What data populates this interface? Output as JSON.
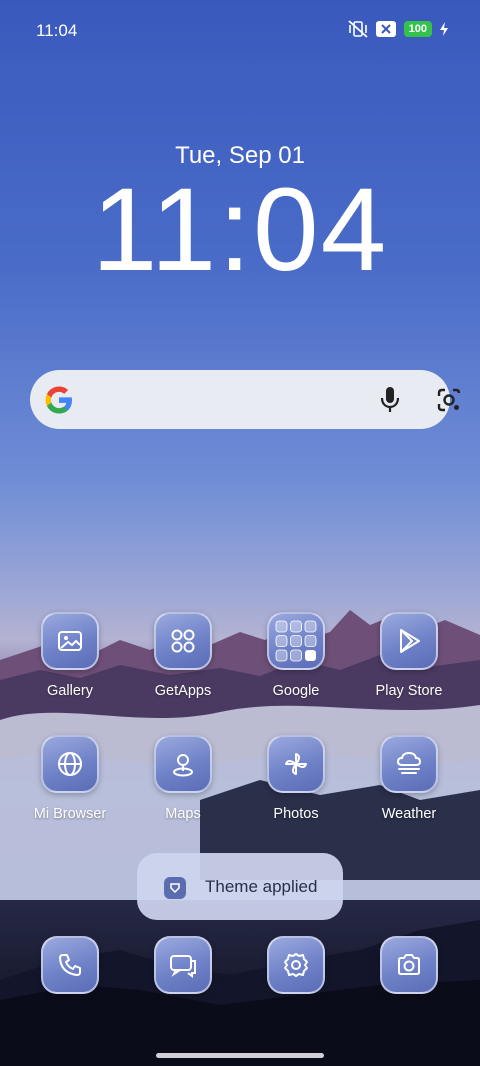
{
  "status_bar": {
    "time": "11:04",
    "battery": "100",
    "icons": [
      "vibrate-off-icon",
      "close-box-icon",
      "battery-icon",
      "charging-icon"
    ]
  },
  "clock_widget": {
    "date": "Tue, Sep 01",
    "time": "11:04"
  },
  "search_bar": {
    "icons": [
      "google-logo-icon",
      "microphone-icon",
      "lens-camera-icon"
    ]
  },
  "apps_row1": [
    {
      "label": "Gallery",
      "icon": "image-icon"
    },
    {
      "label": "GetApps",
      "icon": "grid-circles-icon"
    },
    {
      "label": "Google",
      "icon": "folder-icon"
    },
    {
      "label": "Play Store",
      "icon": "play-triangle-icon"
    }
  ],
  "apps_row2": [
    {
      "label": "Mi Browser",
      "icon": "globe-icon"
    },
    {
      "label": "Maps",
      "icon": "map-pin-icon"
    },
    {
      "label": "Photos",
      "icon": "pinwheel-icon"
    },
    {
      "label": "Weather",
      "icon": "cloud-fog-icon"
    }
  ],
  "dock": [
    {
      "icon": "phone-icon"
    },
    {
      "icon": "messages-icon"
    },
    {
      "icon": "settings-gear-icon"
    },
    {
      "icon": "camera-icon"
    }
  ],
  "toast": {
    "text": "Theme applied",
    "icon": "theme-icon"
  },
  "colors": {
    "tile": "#6f82c8",
    "search_bg": "#e9ebf2",
    "battery": "#35c24a"
  }
}
